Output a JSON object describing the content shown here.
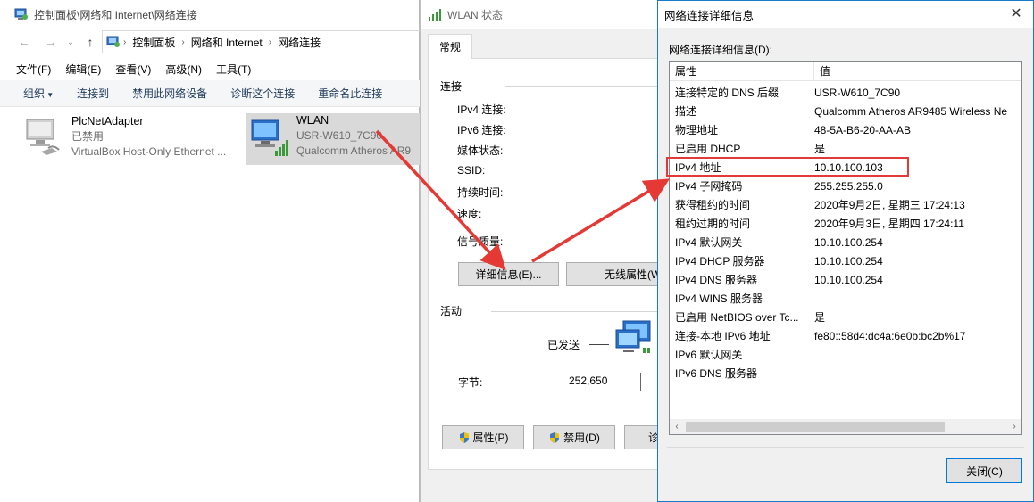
{
  "explorer": {
    "title": "控制面板\\网络和 Internet\\网络连接",
    "breadcrumb": [
      "控制面板",
      "网络和 Internet",
      "网络连接"
    ],
    "menu": [
      "文件(F)",
      "编辑(E)",
      "查看(V)",
      "高级(N)",
      "工具(T)"
    ],
    "commands": [
      "组织",
      "连接到",
      "禁用此网络设备",
      "诊断这个连接",
      "重命名此连接"
    ],
    "adapters": [
      {
        "name": "PlcNetAdapter",
        "status": "已禁用",
        "device": "VirtualBox Host-Only Ethernet ..."
      },
      {
        "name": "WLAN",
        "status": "USR-W610_7C90",
        "device": "Qualcomm Atheros AR9"
      }
    ]
  },
  "wlan": {
    "title": "WLAN 状态",
    "tab": "常规",
    "group_connection": "连接",
    "fields": [
      "IPv4 连接:",
      "IPv6 连接:",
      "媒体状态:",
      "SSID:",
      "持续时间:",
      "速度:",
      "信号质量:"
    ],
    "details_button": "详细信息(E)...",
    "wireless_button": "无线属性(W",
    "group_activity": "活动",
    "sent_label": "已发送",
    "bytes_label": "字节:",
    "bytes_sent": "252,650",
    "properties_button": "属性(P)",
    "disable_button": "禁用(D)",
    "diagnose_button": "诊"
  },
  "details": {
    "title": "网络连接详细信息",
    "list_label": "网络连接详细信息(D):",
    "col_property": "属性",
    "col_value": "值",
    "rows": [
      {
        "p": "连接特定的 DNS 后缀",
        "v": "USR-W610_7C90"
      },
      {
        "p": "描述",
        "v": "Qualcomm Atheros AR9485 Wireless Ne"
      },
      {
        "p": "物理地址",
        "v": "48-5A-B6-20-AA-AB"
      },
      {
        "p": "已启用 DHCP",
        "v": "是"
      },
      {
        "p": "IPv4 地址",
        "v": "10.10.100.103"
      },
      {
        "p": "IPv4 子网掩码",
        "v": "255.255.255.0"
      },
      {
        "p": "获得租约的时间",
        "v": "2020年9月2日, 星期三 17:24:13"
      },
      {
        "p": "租约过期的时间",
        "v": "2020年9月3日, 星期四 17:24:11"
      },
      {
        "p": "IPv4 默认网关",
        "v": "10.10.100.254"
      },
      {
        "p": "IPv4 DHCP 服务器",
        "v": "10.10.100.254"
      },
      {
        "p": "IPv4 DNS 服务器",
        "v": "10.10.100.254"
      },
      {
        "p": "IPv4 WINS 服务器",
        "v": ""
      },
      {
        "p": "已启用 NetBIOS over Tc...",
        "v": "是"
      },
      {
        "p": "连接-本地 IPv6 地址",
        "v": "fe80::58d4:dc4a:6e0b:bc2b%17"
      },
      {
        "p": "IPv6 默认网关",
        "v": ""
      },
      {
        "p": "IPv6 DNS 服务器",
        "v": ""
      }
    ],
    "close_button": "关闭(C)"
  },
  "colors": {
    "highlight": "#e23a3a",
    "accent": "#0078d7"
  }
}
